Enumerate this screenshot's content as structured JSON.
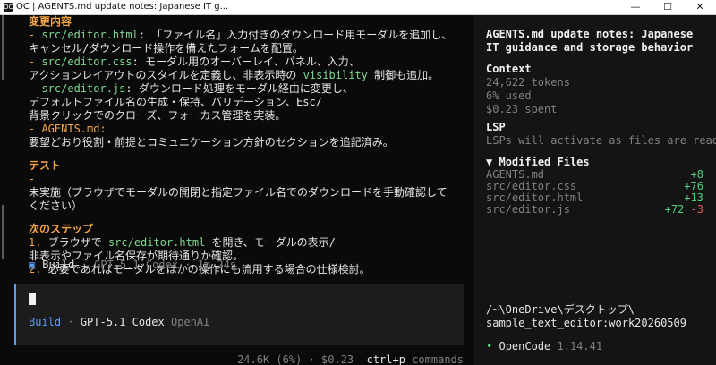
{
  "window": {
    "title": "OC | AGENTS.md update notes: Japanese IT g...",
    "icon_label": "OC",
    "min_glyph": "—",
    "max_glyph": "☐",
    "close_glyph": "✕"
  },
  "conversation": {
    "changes_heading": "変更内容",
    "changes": [
      {
        "bullet": "- ",
        "file": "src/editor.html",
        "sep": ": ",
        "text": "「ファイル名」入力付きのダウンロード用モーダルを追加し、",
        "cont": [
          "キャンセル/ダウンロード操作を備えたフォームを配置。"
        ]
      },
      {
        "bullet": "- ",
        "file": "src/editor.css",
        "sep": ": ",
        "text": "モーダル用のオーバーレイ、パネル、入力、",
        "cont_parts": [
          "アクションレイアウトのスタイルを定義し、非表示時の ",
          "visibility",
          " 制御も追加。"
        ]
      },
      {
        "bullet": "- ",
        "file": "src/editor.js",
        "sep": ": ",
        "text": "ダウンロード処理をモーダル経由に変更し、",
        "cont": [
          "デフォルトファイル名の生成・保持、バリデーション、Esc/",
          "背景クリックでのクローズ、フォーカス管理を実装。"
        ]
      },
      {
        "bullet": "- ",
        "file": "AGENTS.md",
        "sep": ":",
        "text": "",
        "cont": [
          "要望どおり役割・前提とコミュニケーション方針のセクションを追記済み。"
        ]
      }
    ],
    "test_heading": "テスト",
    "test_bullet": "-",
    "test_lines": [
      "未実施（ブラウザでモーダルの開閉と指定ファイル名でのダウンロードを手動確認して",
      "ください）"
    ],
    "next_heading": "次のステップ",
    "next_items": [
      {
        "num": "1. ",
        "pre": "ブラウザで ",
        "file": "src/editor.html",
        "post": " を開き、モーダルの表示/",
        "cont": "非表示やファイル名保存が期待通りか確認。"
      },
      {
        "num": "2. ",
        "pre": "必要であればモーダルをほかの操作にも流用する場合の仕様検討。",
        "file": "",
        "post": "",
        "cont": ""
      }
    ]
  },
  "status_line": {
    "icon": "▣",
    "agent": "Build",
    "model": "GPT-5.1 Codex",
    "duration": "1m 24s",
    "dot": "·"
  },
  "input": {
    "mode": "Build",
    "model": "GPT-5.1 Codex",
    "provider": "OpenAI",
    "dot": "·"
  },
  "bottom_bar": {
    "tokens": "24.6K (6%)",
    "cost": "$0.23",
    "shortcut_key": "ctrl+p",
    "shortcut_label": "commands",
    "dot": "·"
  },
  "sidebar": {
    "title": "AGENTS.md update notes: Japanese IT guidance and storage behavior",
    "context_heading": "Context",
    "tokens": "24,622 tokens",
    "used": "6% used",
    "spent": "$0.23 spent",
    "lsp_heading": "LSP",
    "lsp_text": "LSPs will activate as files are read",
    "modified_heading": "Modified Files",
    "modified_toggle": "▼",
    "files": [
      {
        "name": "AGENTS.md",
        "plus": "+8",
        "minus": ""
      },
      {
        "name": "src/editor.css",
        "plus": "+76",
        "minus": ""
      },
      {
        "name": "src/editor.html",
        "plus": "+13",
        "minus": ""
      },
      {
        "name": "src/editor.js",
        "plus": "+72",
        "minus": "-3"
      }
    ],
    "cwd_line1": "/~\\OneDrive\\デスクトップ\\",
    "cwd_line2": "sample_text_editor:work20260509",
    "app_dot": "•",
    "app_name": "OpenCode",
    "version": "1.14.41"
  },
  "colors": {
    "accent_orange": "#f5a54a",
    "path_green": "#7fd88f",
    "mode_blue": "#5c9cf5",
    "add_green": "#4fd07a",
    "del_red": "#e05858"
  }
}
